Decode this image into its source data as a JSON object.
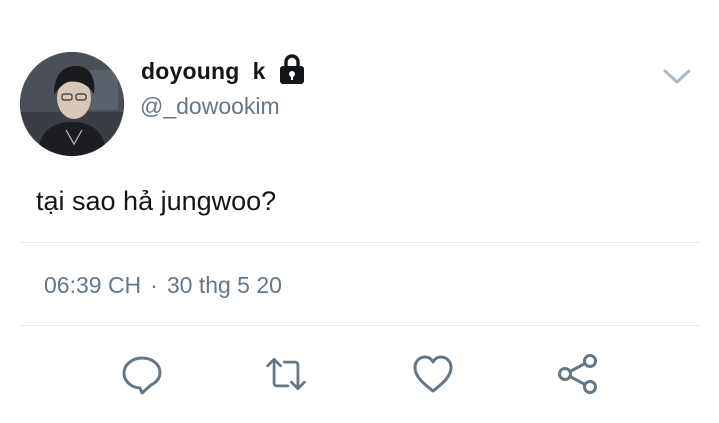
{
  "user": {
    "display_name": "doyoung  k",
    "handle": "@_dowookim",
    "protected_icon": "lock-icon",
    "avatar": "profile-photo"
  },
  "tweet": {
    "text": "tại sao hả jungwoo?",
    "time": "06:39 CH",
    "separator": "·",
    "date": "30 thg 5 20"
  },
  "menu_icon": "chevron-down-icon",
  "actions": [
    {
      "name": "reply",
      "icon": "reply-icon"
    },
    {
      "name": "retweet",
      "icon": "retweet-icon"
    },
    {
      "name": "like",
      "icon": "heart-icon"
    },
    {
      "name": "share",
      "icon": "share-icon"
    }
  ],
  "colors": {
    "text": "#14171a",
    "secondary": "#657786",
    "divider": "#e6ecf0",
    "icon": "#657786"
  }
}
